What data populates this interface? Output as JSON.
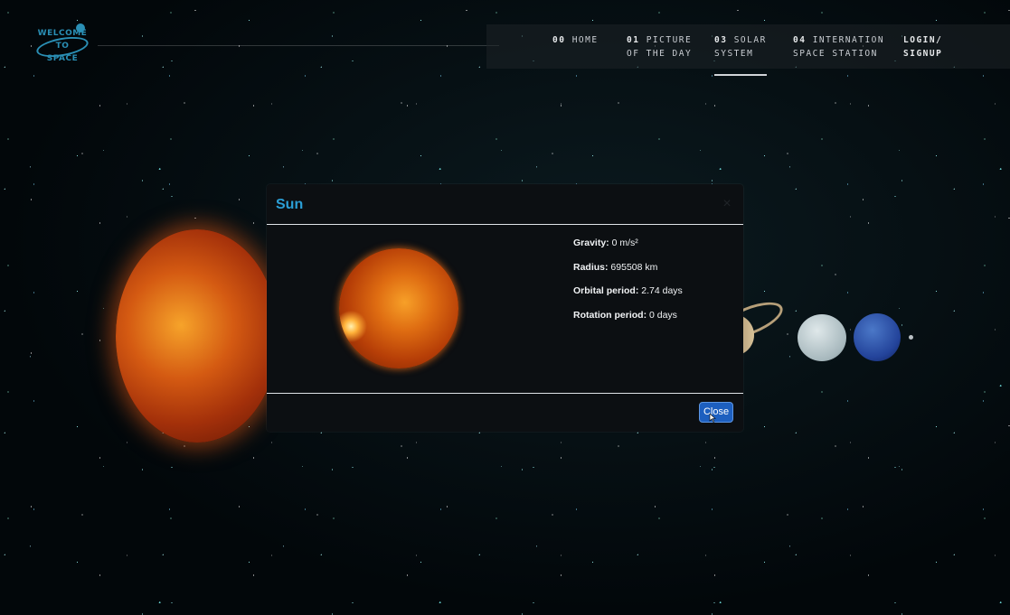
{
  "logo": {
    "lines": [
      "WELCOME",
      "TO",
      "SPACE"
    ]
  },
  "nav": {
    "items": [
      {
        "num": "00",
        "label": "HOME"
      },
      {
        "num": "01",
        "label": "PICTURE",
        "label2": "OF THE DAY"
      },
      {
        "num": "03",
        "label": "SOLAR",
        "label2": "SYSTEM"
      },
      {
        "num": "04",
        "label": "INTERNATION",
        "label2": "SPACE STATION"
      },
      {
        "num": "",
        "label": "LOGIN/",
        "label2": "SIGNUP"
      }
    ],
    "active_index": 2
  },
  "modal": {
    "title": "Sun",
    "close_glyph": "×",
    "facts": [
      {
        "key": "Gravity:",
        "value": " 0 m/s²"
      },
      {
        "key": "Radius:",
        "value": " 695508 km"
      },
      {
        "key": "Orbital period:",
        "value": " 2.74 days"
      },
      {
        "key": "Rotation period:",
        "value": " 0 days"
      }
    ],
    "close_label": "Close"
  },
  "icons": {
    "cursor": "pointer-cursor-icon"
  },
  "colors": {
    "accent": "#2b9fd6",
    "button": "#1d5fbf",
    "logo": "#2a8fb5"
  }
}
